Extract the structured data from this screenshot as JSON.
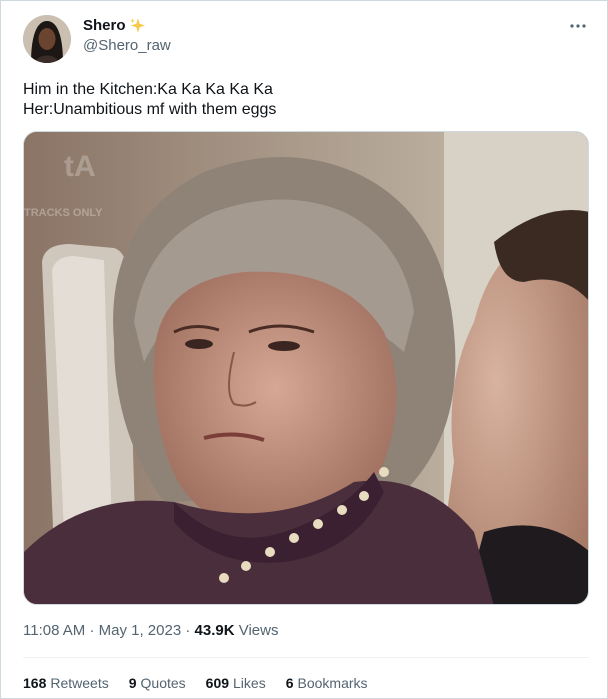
{
  "author": {
    "display_name": "Shero",
    "handle": "@Shero_raw",
    "badge_icon": "sparkle-icon",
    "avatar_icon": "avatar"
  },
  "more_icon": "ellipsis-icon",
  "tweet": {
    "lines": [
      "Him in the Kitchen:Ka Ka Ka Ka Ka",
      "Her:Unambitious mf with them eggs"
    ]
  },
  "media": {
    "kind": "photo",
    "watermark": "TRACKS ONLY"
  },
  "meta": {
    "time": "11:08 AM",
    "separator": "·",
    "date": "May 1, 2023",
    "views_count": "43.9K",
    "views_label": "Views"
  },
  "stats": [
    {
      "count": "168",
      "label": "Retweets"
    },
    {
      "count": "9",
      "label": "Quotes"
    },
    {
      "count": "609",
      "label": "Likes"
    },
    {
      "count": "6",
      "label": "Bookmarks"
    }
  ],
  "colors": {
    "text_primary": "#0f1419",
    "text_secondary": "#536471",
    "border": "#cfd9de",
    "badge": "#f7c948"
  }
}
